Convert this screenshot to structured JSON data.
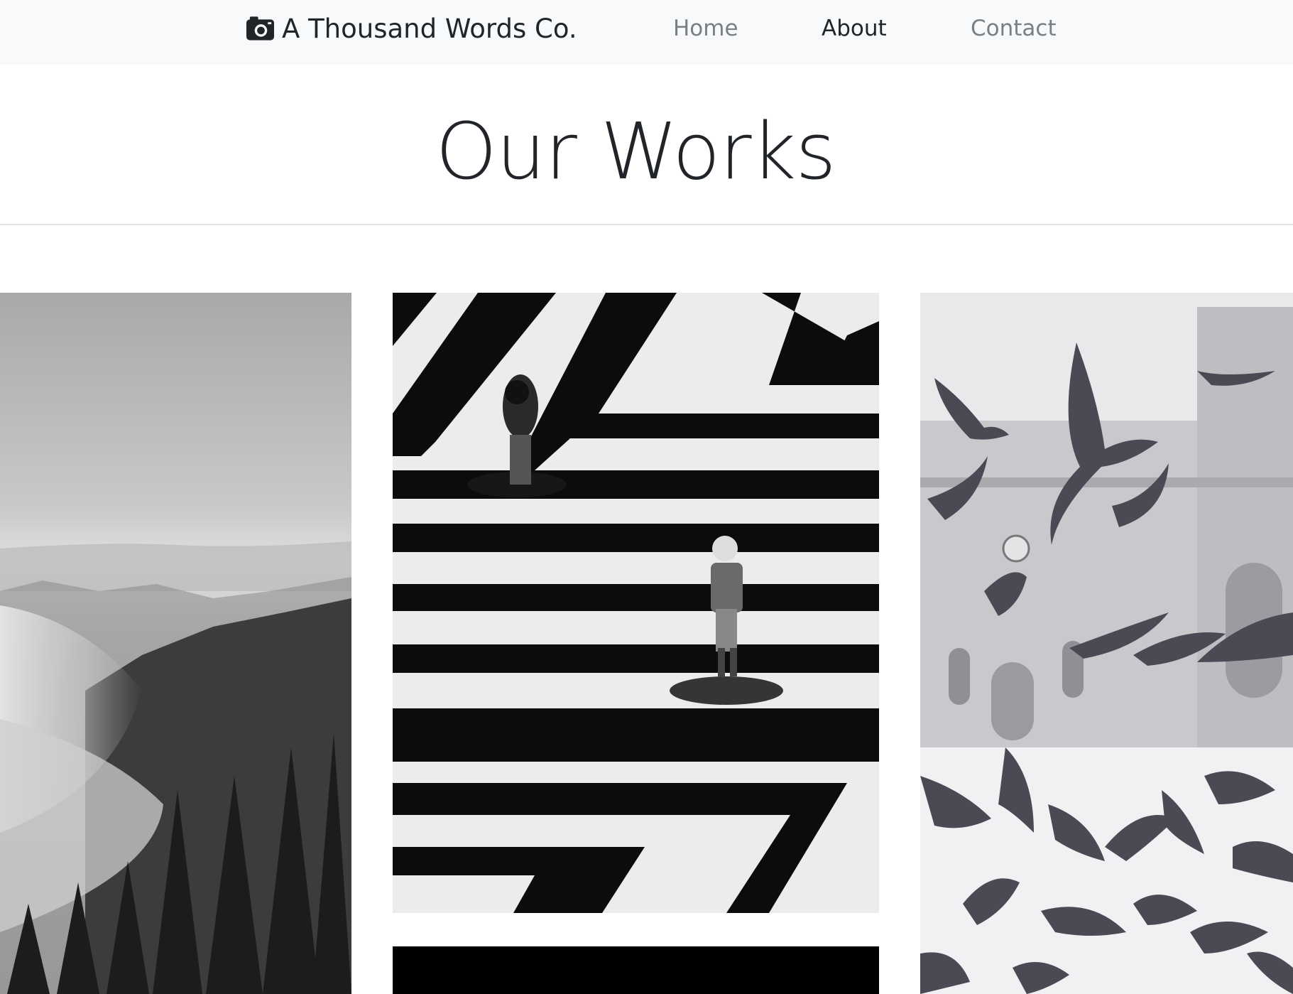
{
  "navbar": {
    "brand_label": "A Thousand Words Co.",
    "brand_icon": "camera-icon",
    "links": [
      {
        "label": "Home",
        "active": false
      },
      {
        "label": "About",
        "active": true
      },
      {
        "label": "Contact",
        "active": false
      }
    ]
  },
  "main": {
    "title": "Our Works"
  },
  "gallery": {
    "photos": [
      {
        "subject": "misty forest"
      },
      {
        "subject": "pedestrian crosswalk"
      },
      {
        "subject": "pigeons in flight"
      },
      {
        "subject": "dark photo"
      }
    ]
  },
  "colors": {
    "navbar_bg": "#f8f9fa",
    "text_dark": "#212529",
    "nav_muted": "#7b7f83",
    "divider": "#e3e5e8"
  }
}
